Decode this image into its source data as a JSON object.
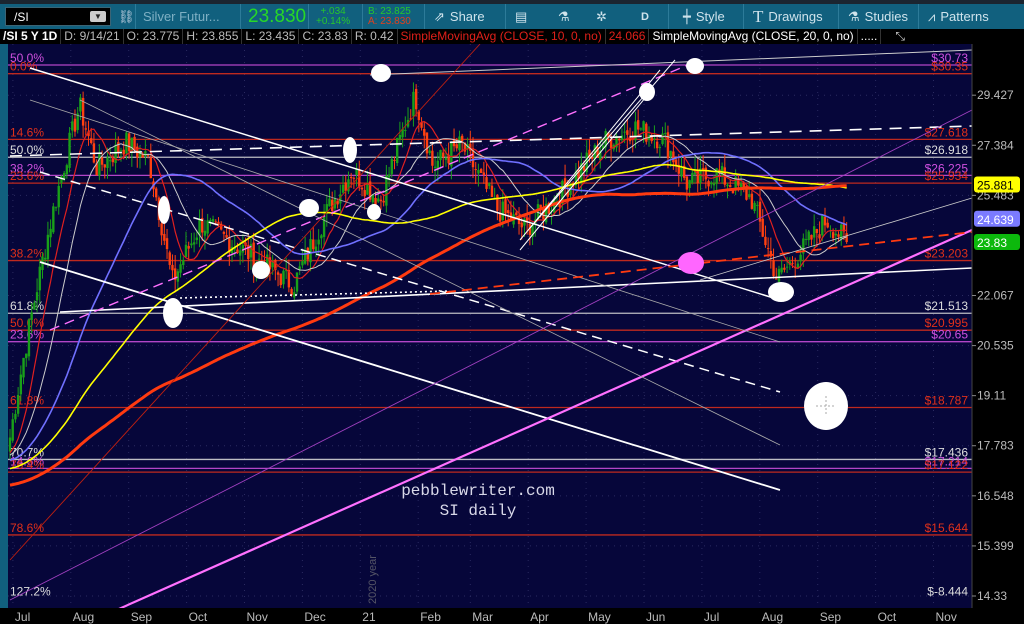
{
  "toolbar": {
    "symbol": "/SI",
    "description": "Silver Futur...",
    "last": "23.830",
    "change": "+.034",
    "change_pct": "+0.14%",
    "bid": "B: 23.825",
    "ask": "A: 23.830",
    "share": "Share",
    "aggregation": "D",
    "style": "Style",
    "drawings": "Drawings",
    "studies": "Studies",
    "patterns": "Patterns"
  },
  "infobar": {
    "title": "/SI 5 Y 1D",
    "date": "D: 9/14/21",
    "open": "O: 23.775",
    "high": "H: 23.855",
    "low": "L: 23.435",
    "close": "C: 23.83",
    "range": "R: 0.42",
    "sma10_label": "SimpleMovingAvg (CLOSE, 10, 0, no)",
    "sma10_value": "24.066",
    "sma20_label": "SimpleMovingAvg (CLOSE, 20, 0, no)",
    "more": "....."
  },
  "chart_data": {
    "type": "candlestick",
    "title": "/SI 5 Y 1D",
    "scale": "log",
    "ylim": [
      14.0,
      31.2
    ],
    "y_ticks": [
      "29.427",
      "27.384",
      "25.483",
      "22.067",
      "20.535",
      "19.11",
      "17.783",
      "16.548",
      "15.399",
      "14.33"
    ],
    "x_ticks": [
      "Jul",
      "Aug",
      "Sep",
      "Oct",
      "Nov",
      "Dec",
      "21",
      "Feb",
      "Mar",
      "Apr",
      "May",
      "Jun",
      "Jul",
      "Aug",
      "Sep",
      "Oct",
      "Nov"
    ],
    "year_marker": "2020 year",
    "price_path": [
      {
        "m": 0.0,
        "c": 18.0
      },
      {
        "m": 0.7,
        "c": 24.5
      },
      {
        "m": 1.2,
        "c": 29.0
      },
      {
        "m": 1.5,
        "c": 26.5
      },
      {
        "m": 2.0,
        "c": 27.5
      },
      {
        "m": 2.4,
        "c": 26.8
      },
      {
        "m": 2.8,
        "c": 22.5
      },
      {
        "m": 3.3,
        "c": 24.5
      },
      {
        "m": 4.0,
        "c": 23.6
      },
      {
        "m": 4.9,
        "c": 22.4
      },
      {
        "m": 5.5,
        "c": 25.0
      },
      {
        "m": 5.9,
        "c": 26.4
      },
      {
        "m": 6.4,
        "c": 25.3
      },
      {
        "m": 7.0,
        "c": 29.4
      },
      {
        "m": 7.3,
        "c": 26.6
      },
      {
        "m": 7.8,
        "c": 27.4
      },
      {
        "m": 8.4,
        "c": 25.0
      },
      {
        "m": 8.9,
        "c": 24.3
      },
      {
        "m": 9.5,
        "c": 25.5
      },
      {
        "m": 10.3,
        "c": 27.6
      },
      {
        "m": 10.8,
        "c": 28.1
      },
      {
        "m": 11.3,
        "c": 27.6
      },
      {
        "m": 11.7,
        "c": 25.9
      },
      {
        "m": 12.2,
        "c": 26.3
      },
      {
        "m": 12.8,
        "c": 25.4
      },
      {
        "m": 13.25,
        "c": 22.6
      },
      {
        "m": 13.7,
        "c": 23.6
      },
      {
        "m": 14.1,
        "c": 24.6
      },
      {
        "m": 14.45,
        "c": 23.83
      }
    ],
    "indicators": [
      {
        "name": "SMA 10",
        "color": "#e02020",
        "last": "24.066"
      },
      {
        "name": "SMA 20",
        "color": "#cccccc"
      },
      {
        "name": "SMA blue",
        "color": "#7070ff",
        "last": "24.639"
      },
      {
        "name": "SMA yellow",
        "color": "#ffff00",
        "last": "25.881"
      },
      {
        "name": "SMA long",
        "color": "#ff3a10"
      }
    ],
    "last_badges": [
      {
        "value": "25.881",
        "price": 25.881,
        "bg": "#ffff00",
        "fg": "#000"
      },
      {
        "value": "24.639",
        "price": 24.639,
        "bg": "#7b7bff",
        "fg": "#fff"
      },
      {
        "value": "23.83",
        "price": 23.83,
        "bg": "#0cb80c",
        "fg": "#fff"
      }
    ],
    "levels": [
      {
        "price": 30.73,
        "label": "$30.73",
        "pct": "50.0%",
        "color": "#d050e0"
      },
      {
        "price": 30.35,
        "label": "$30.35",
        "pct": "0.0%",
        "color": "#e0301a"
      },
      {
        "price": 27.618,
        "label": "$27.618",
        "pct": "14.6%",
        "color": "#e0301a"
      },
      {
        "price": 26.918,
        "label": "$26.918",
        "pct": "50.0%",
        "color": "#dddddd"
      },
      {
        "price": 26.225,
        "label": "$26.225",
        "pct": "38.2%",
        "color": "#d050e0"
      },
      {
        "price": 25.934,
        "label": "$25.934",
        "pct": "23.6%",
        "color": "#e0301a"
      },
      {
        "price": 23.203,
        "label": "$23.203",
        "pct": "38.2%",
        "color": "#e0301a"
      },
      {
        "price": 21.513,
        "label": "$21.513",
        "pct": "61.8%",
        "color": "#dddddd"
      },
      {
        "price": 20.995,
        "label": "$20.995",
        "pct": "50.0%",
        "color": "#e0301a"
      },
      {
        "price": 20.65,
        "label": "$20.65",
        "pct": "23.6%",
        "color": "#d050e0"
      },
      {
        "price": 18.787,
        "label": "$18.787",
        "pct": "61.8%",
        "color": "#e0301a"
      },
      {
        "price": 17.436,
        "label": "$17.436",
        "pct": "70.7%",
        "color": "#dddddd"
      },
      {
        "price": 17.214,
        "label": "$17.214",
        "pct": "14.6%",
        "color": "#d050e0"
      },
      {
        "price": 17.122,
        "label": "$17.122",
        "pct": "76.4%",
        "color": "#e0301a"
      },
      {
        "price": 15.644,
        "label": "$15.644",
        "pct": "78.6%",
        "color": "#e0301a"
      },
      {
        "price": 14.28,
        "label": "$-8.444",
        "pct": "127.2%",
        "color": "#dddddd",
        "noline": true
      }
    ]
  },
  "watermark": {
    "line1": "pebblewriter.com",
    "line2": "SI daily"
  },
  "colors": {
    "bg": "#06063a",
    "up": "#19a019",
    "down": "#ff4010"
  }
}
